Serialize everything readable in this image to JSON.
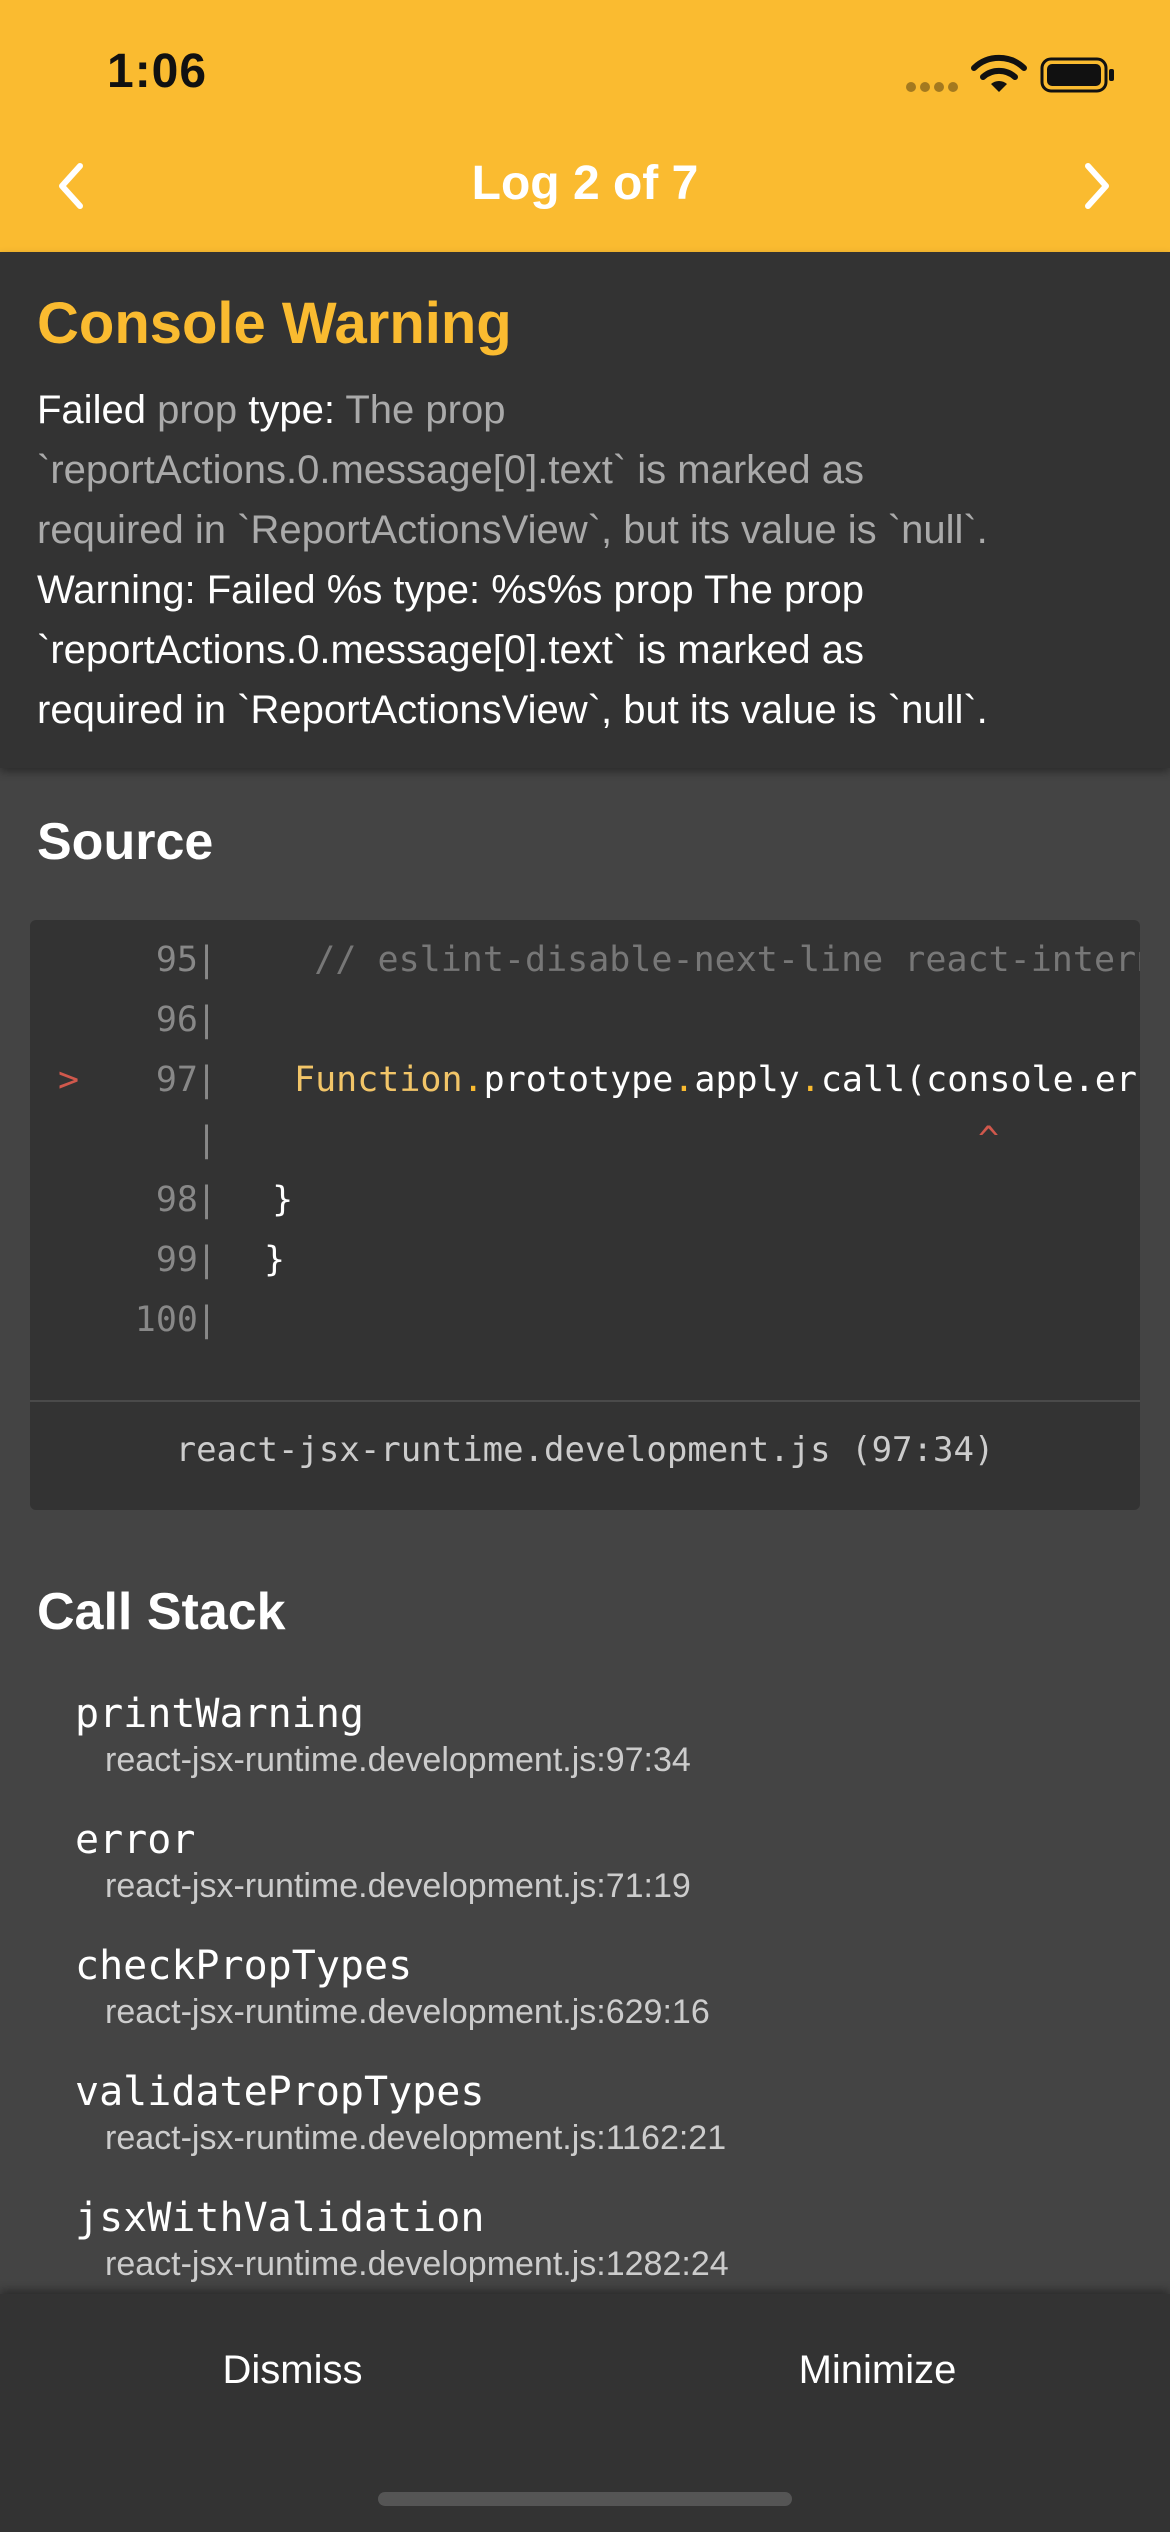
{
  "status_bar": {
    "time": "1:06",
    "icons": [
      "signal-dots-icon",
      "wifi-icon",
      "battery-icon"
    ]
  },
  "header": {
    "title": "Log 2 of 7",
    "prev_icon": "chevron-left-icon",
    "next_icon": "chevron-right-icon"
  },
  "colors": {
    "accent": "#FABB30",
    "header_bg": "#FABB30",
    "panel_bg": "#333333",
    "page_bg": "#444444",
    "error_marker": "#D0584C"
  },
  "warning": {
    "title": "Console Warning",
    "message_parts": [
      "Failed",
      " prop",
      " type:",
      " The prop",
      "`reportActions.0.message[0].text` is marked as",
      "required in `ReportActionsView`, but its value is `null`."
    ],
    "detail_lines": [
      "Warning: Failed %s type: %s%s prop The prop",
      "`reportActions.0.message[0].text` is marked as",
      "required in `ReportActionsView`, but its value is `null`."
    ]
  },
  "source": {
    "title": "Source",
    "lines": [
      {
        "marker": "",
        "num": "95",
        "pipe": "|",
        "text": "    // eslint-disable-next-line react-internal/no-production-logging"
      },
      {
        "marker": "",
        "num": "96",
        "pipe": "|",
        "text": ""
      },
      {
        "marker": ">",
        "num": "97",
        "pipe": "|",
        "t1": "Function",
        "d1": ".",
        "t2": "prototype",
        "d2": ".",
        "t3": "apply",
        "d3": ".",
        "t4": "call(console.error, console, argsWithFormat);"
      },
      {
        "marker": "",
        "num": "",
        "pipe": "|",
        "caret": "^"
      },
      {
        "marker": "",
        "num": "98",
        "pipe": "|",
        "text": "  }"
      },
      {
        "marker": "",
        "num": "99",
        "pipe": "|",
        "text": "}"
      },
      {
        "marker": "",
        "num": "100",
        "pipe": "|",
        "text": ""
      }
    ],
    "file": "react-jsx-runtime.development.js (97:34)"
  },
  "call_stack": {
    "title": "Call Stack",
    "frames": [
      {
        "fn": "printWarning",
        "loc": "react-jsx-runtime.development.js:97:34"
      },
      {
        "fn": "error",
        "loc": "react-jsx-runtime.development.js:71:19"
      },
      {
        "fn": "checkPropTypes",
        "loc": "react-jsx-runtime.development.js:629:16"
      },
      {
        "fn": "validatePropTypes",
        "loc": "react-jsx-runtime.development.js:1162:21"
      },
      {
        "fn": "jsxWithValidation",
        "loc": "react-jsx-runtime.development.js:1282:24"
      }
    ]
  },
  "footer": {
    "dismiss": "Dismiss",
    "minimize": "Minimize"
  }
}
